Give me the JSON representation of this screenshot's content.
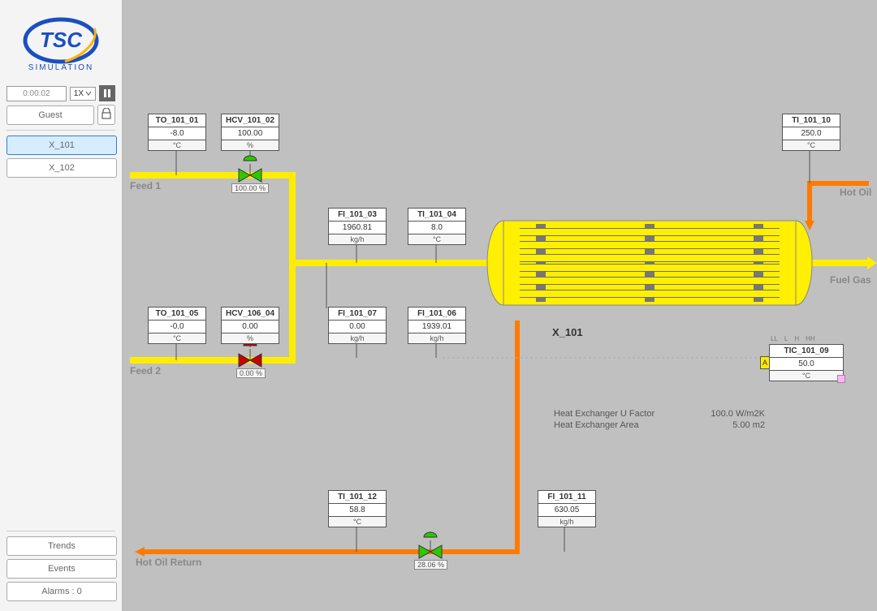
{
  "sidebar": {
    "time": "0:00:02",
    "speed": "1X",
    "user": "Guest",
    "pages": [
      "X_101",
      "X_102"
    ],
    "active_page": 0,
    "nav": {
      "trends": "Trends",
      "events": "Events",
      "alarms": "Alarms : 0"
    }
  },
  "labels": {
    "feed1": "Feed 1",
    "feed2": "Feed 2",
    "hot_oil": "Hot Oil",
    "hot_oil_return": "Hot Oil Return",
    "fuel_gas": "Fuel Gas",
    "hx": "X_101"
  },
  "instruments": {
    "to_101_01": {
      "tag": "TO_101_01",
      "val": "-8.0",
      "unit": "°C"
    },
    "hcv_101_02": {
      "tag": "HCV_101_02",
      "val": "100.00",
      "unit": "%"
    },
    "fi_101_03": {
      "tag": "FI_101_03",
      "val": "1960.81",
      "unit": "kg/h"
    },
    "ti_101_04": {
      "tag": "TI_101_04",
      "val": "8.0",
      "unit": "°C"
    },
    "to_101_05": {
      "tag": "TO_101_05",
      "val": "-0.0",
      "unit": "°C"
    },
    "hcv_106_04": {
      "tag": "HCV_106_04",
      "val": "0.00",
      "unit": "%"
    },
    "fi_101_07": {
      "tag": "FI_101_07",
      "val": "0.00",
      "unit": "kg/h"
    },
    "fi_101_06": {
      "tag": "FI_101_06",
      "val": "1939.01",
      "unit": "kg/h"
    },
    "tic_101_09": {
      "tag": "TIC_101_09",
      "val": "50.0",
      "unit": "°C"
    },
    "ti_101_10": {
      "tag": "TI_101_10",
      "val": "250.0",
      "unit": "°C"
    },
    "fi_101_11": {
      "tag": "FI_101_11",
      "val": "630.05",
      "unit": "kg/h"
    },
    "ti_101_12": {
      "tag": "TI_101_12",
      "val": "58.8",
      "unit": "°C"
    }
  },
  "valves": {
    "v1": {
      "pct": "100.00 %"
    },
    "v2": {
      "pct": "0.00 %"
    },
    "v3": {
      "pct": "28.06 %"
    }
  },
  "info": {
    "u_label": "Heat Exchanger U Factor",
    "u_val": "100.0 W/m2K",
    "a_label": "Heat Exchanger Area",
    "a_val": "5.00 m2"
  },
  "alarm_ticks": {
    "ll": "LL",
    "l": "L",
    "h": "H",
    "hh": "HH"
  }
}
